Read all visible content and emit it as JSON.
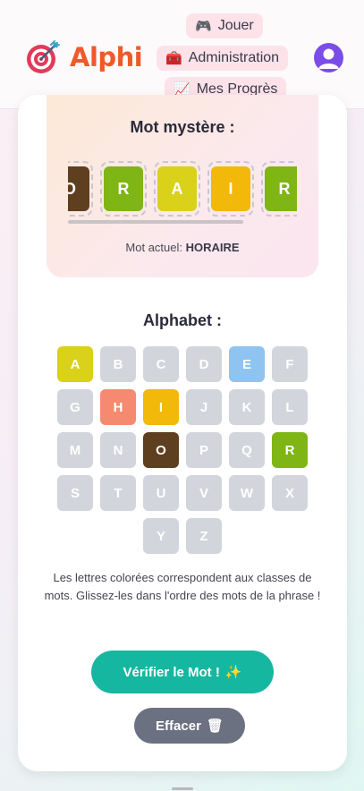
{
  "header": {
    "logo_text": "Alphi",
    "nav": {
      "jouer": {
        "icon": "🎮",
        "label": "Jouer"
      },
      "admin": {
        "icon": "🧰",
        "label": "Administration"
      },
      "progres": {
        "icon": "📈",
        "label": "Mes Progrès"
      }
    }
  },
  "mystery": {
    "title": "Mot mystère :",
    "tiles": [
      {
        "letter": "O",
        "color": "#5e3f1f"
      },
      {
        "letter": "R",
        "color": "#7fb514"
      },
      {
        "letter": "A",
        "color": "#d9d11a"
      },
      {
        "letter": "I",
        "color": "#f2b80a"
      },
      {
        "letter": "R",
        "color": "#7fb514"
      }
    ],
    "current_label": "Mot actuel:",
    "current_word": "HORAIRE"
  },
  "alphabet": {
    "title": "Alphabet :",
    "letters": [
      {
        "letter": "A",
        "color": "#d9d11a"
      },
      {
        "letter": "B",
        "color": "#d2d5db"
      },
      {
        "letter": "C",
        "color": "#d2d5db"
      },
      {
        "letter": "D",
        "color": "#d2d5db"
      },
      {
        "letter": "E",
        "color": "#8fc3f0"
      },
      {
        "letter": "F",
        "color": "#d2d5db"
      },
      {
        "letter": "G",
        "color": "#d2d5db"
      },
      {
        "letter": "H",
        "color": "#f58a70"
      },
      {
        "letter": "I",
        "color": "#f2b80a"
      },
      {
        "letter": "J",
        "color": "#d2d5db"
      },
      {
        "letter": "K",
        "color": "#d2d5db"
      },
      {
        "letter": "L",
        "color": "#d2d5db"
      },
      {
        "letter": "M",
        "color": "#d2d5db"
      },
      {
        "letter": "N",
        "color": "#d2d5db"
      },
      {
        "letter": "O",
        "color": "#5e3f1f"
      },
      {
        "letter": "P",
        "color": "#d2d5db"
      },
      {
        "letter": "Q",
        "color": "#d2d5db"
      },
      {
        "letter": "R",
        "color": "#7fb514"
      },
      {
        "letter": "S",
        "color": "#d2d5db"
      },
      {
        "letter": "T",
        "color": "#d2d5db"
      },
      {
        "letter": "U",
        "color": "#d2d5db"
      },
      {
        "letter": "V",
        "color": "#d2d5db"
      },
      {
        "letter": "W",
        "color": "#d2d5db"
      },
      {
        "letter": "X",
        "color": "#d2d5db"
      },
      {
        "letter": "Y",
        "color": "#d2d5db"
      },
      {
        "letter": "Z",
        "color": "#d2d5db"
      }
    ]
  },
  "help_text": "Les lettres colorées correspondent aux classes de mots. Glissez-les dans l'ordre des mots de la phrase !",
  "buttons": {
    "verify": {
      "label": "Vérifier le Mot !",
      "icon": "✨"
    },
    "clear": {
      "label": "Effacer",
      "icon": "🗑"
    }
  }
}
